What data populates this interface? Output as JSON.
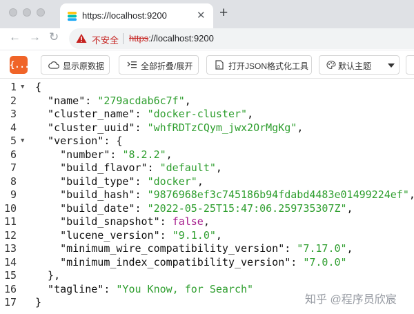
{
  "browser": {
    "tab": {
      "title": "https://localhost:9200",
      "close_glyph": "✕"
    },
    "new_tab_glyph": "+",
    "nav": {
      "back": "←",
      "forward": "→",
      "reload": "↻"
    },
    "omnibox": {
      "security_label": "不安全",
      "url_scheme": "https",
      "url_rest": "://localhost:9200"
    }
  },
  "extension_toolbar": {
    "logo_text": "{...}",
    "buttons": [
      {
        "label": "显示原数据",
        "icon": "cloud-icon"
      },
      {
        "label": "全部折叠/展开",
        "icon": "collapse-icon"
      },
      {
        "label": "打开JSON格式化工具",
        "icon": "document-icon"
      }
    ],
    "theme_select": {
      "label": "默认主题",
      "icon": "palette-icon"
    }
  },
  "code": {
    "lines": [
      {
        "n": "1",
        "fold": "▼",
        "parts": [
          {
            "t": "{",
            "c": "p"
          }
        ]
      },
      {
        "n": "2",
        "parts": [
          {
            "t": "  \"name\"",
            "c": "k"
          },
          {
            "t": ": ",
            "c": "p"
          },
          {
            "t": "\"279acdab6c7f\"",
            "c": "s"
          },
          {
            "t": ",",
            "c": "p"
          }
        ]
      },
      {
        "n": "3",
        "parts": [
          {
            "t": "  \"cluster_name\"",
            "c": "k"
          },
          {
            "t": ": ",
            "c": "p"
          },
          {
            "t": "\"docker-cluster\"",
            "c": "s"
          },
          {
            "t": ",",
            "c": "p"
          }
        ]
      },
      {
        "n": "4",
        "parts": [
          {
            "t": "  \"cluster_uuid\"",
            "c": "k"
          },
          {
            "t": ": ",
            "c": "p"
          },
          {
            "t": "\"whfRDTzCQym_jwx2OrMgKg\"",
            "c": "s"
          },
          {
            "t": ",",
            "c": "p"
          }
        ]
      },
      {
        "n": "5",
        "fold": "▼",
        "parts": [
          {
            "t": "  \"version\"",
            "c": "k"
          },
          {
            "t": ": {",
            "c": "p"
          }
        ]
      },
      {
        "n": "6",
        "parts": [
          {
            "t": "    \"number\"",
            "c": "k"
          },
          {
            "t": ": ",
            "c": "p"
          },
          {
            "t": "\"8.2.2\"",
            "c": "s"
          },
          {
            "t": ",",
            "c": "p"
          }
        ]
      },
      {
        "n": "7",
        "parts": [
          {
            "t": "    \"build_flavor\"",
            "c": "k"
          },
          {
            "t": ": ",
            "c": "p"
          },
          {
            "t": "\"default\"",
            "c": "s"
          },
          {
            "t": ",",
            "c": "p"
          }
        ]
      },
      {
        "n": "8",
        "parts": [
          {
            "t": "    \"build_type\"",
            "c": "k"
          },
          {
            "t": ": ",
            "c": "p"
          },
          {
            "t": "\"docker\"",
            "c": "s"
          },
          {
            "t": ",",
            "c": "p"
          }
        ]
      },
      {
        "n": "9",
        "parts": [
          {
            "t": "    \"build_hash\"",
            "c": "k"
          },
          {
            "t": ": ",
            "c": "p"
          },
          {
            "t": "\"9876968ef3c745186b94fdabd4483e01499224ef\"",
            "c": "s"
          },
          {
            "t": ",",
            "c": "p"
          }
        ]
      },
      {
        "n": "10",
        "parts": [
          {
            "t": "    \"build_date\"",
            "c": "k"
          },
          {
            "t": ": ",
            "c": "p"
          },
          {
            "t": "\"2022-05-25T15:47:06.259735307Z\"",
            "c": "s"
          },
          {
            "t": ",",
            "c": "p"
          }
        ]
      },
      {
        "n": "11",
        "parts": [
          {
            "t": "    \"build_snapshot\"",
            "c": "k"
          },
          {
            "t": ": ",
            "c": "p"
          },
          {
            "t": "false",
            "c": "b"
          },
          {
            "t": ",",
            "c": "p"
          }
        ]
      },
      {
        "n": "12",
        "parts": [
          {
            "t": "    \"lucene_version\"",
            "c": "k"
          },
          {
            "t": ": ",
            "c": "p"
          },
          {
            "t": "\"9.1.0\"",
            "c": "s"
          },
          {
            "t": ",",
            "c": "p"
          }
        ]
      },
      {
        "n": "13",
        "parts": [
          {
            "t": "    \"minimum_wire_compatibility_version\"",
            "c": "k"
          },
          {
            "t": ": ",
            "c": "p"
          },
          {
            "t": "\"7.17.0\"",
            "c": "s"
          },
          {
            "t": ",",
            "c": "p"
          }
        ]
      },
      {
        "n": "14",
        "parts": [
          {
            "t": "    \"minimum_index_compatibility_version\"",
            "c": "k"
          },
          {
            "t": ": ",
            "c": "p"
          },
          {
            "t": "\"7.0.0\"",
            "c": "s"
          }
        ]
      },
      {
        "n": "15",
        "parts": [
          {
            "t": "  },",
            "c": "p"
          }
        ]
      },
      {
        "n": "16",
        "parts": [
          {
            "t": "  \"tagline\"",
            "c": "k"
          },
          {
            "t": ": ",
            "c": "p"
          },
          {
            "t": "\"You Know, for Search\"",
            "c": "s"
          }
        ]
      },
      {
        "n": "17",
        "parts": [
          {
            "t": "}",
            "c": "p"
          }
        ]
      }
    ]
  },
  "watermark": "知乎 @程序员欣宸"
}
